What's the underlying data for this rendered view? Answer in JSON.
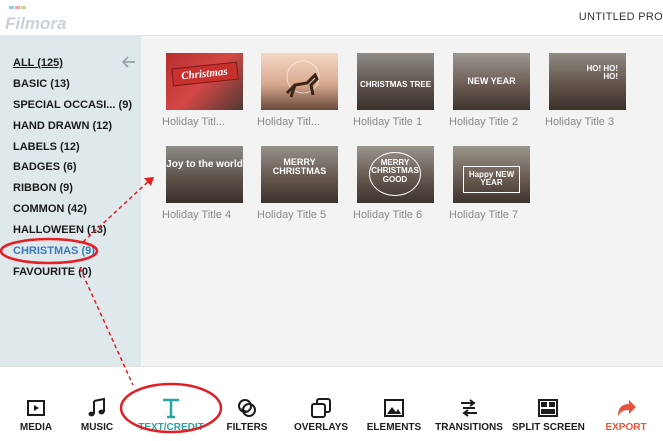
{
  "header": {
    "logo_text": "Filmora",
    "project_title": "UNTITLED PRO"
  },
  "sidebar": {
    "back_icon": "arrow-left-icon",
    "items": [
      {
        "label": "ALL (125)",
        "selected": false,
        "underline": true
      },
      {
        "label": "BASIC (13)"
      },
      {
        "label": "SPECIAL OCCASI...  (9)"
      },
      {
        "label": "HAND DRAWN (12)"
      },
      {
        "label": "LABELS (12)"
      },
      {
        "label": "BADGES (6)"
      },
      {
        "label": "RIBBON (9)"
      },
      {
        "label": "COMMON (42)"
      },
      {
        "label": "HALLOWEEN (13)"
      },
      {
        "label": "CHRISTMAS (9)",
        "selected": true
      },
      {
        "label": "FAVOURITE (0)"
      }
    ]
  },
  "grid": {
    "items": [
      {
        "label": "Holiday Titl...",
        "thumb_text": "Christmas"
      },
      {
        "label": "Holiday Titl...",
        "thumb_text": ""
      },
      {
        "label": "Holiday Title 1",
        "thumb_text": "CHRISTMAS TREE"
      },
      {
        "label": "Holiday Title 2",
        "thumb_text": "NEW YEAR"
      },
      {
        "label": "Holiday Title 3",
        "thumb_text": "HO! HO! HO!"
      },
      {
        "label": "Holiday Title 4",
        "thumb_text": "Joy to the world"
      },
      {
        "label": "Holiday Title 5",
        "thumb_text": "MERRY CHRISTMAS"
      },
      {
        "label": "Holiday Title 6",
        "thumb_text": "MERRY CHRISTMAS GOOD"
      },
      {
        "label": "Holiday Title 7",
        "thumb_text": "Happy NEW YEAR"
      }
    ]
  },
  "toolbar": {
    "items": [
      {
        "label": "MEDIA",
        "icon": "media-icon"
      },
      {
        "label": "MUSIC",
        "icon": "music-note-icon"
      },
      {
        "label": "TEXT/CREDIT",
        "icon": "text-t-icon",
        "active": true
      },
      {
        "label": "FILTERS",
        "icon": "filters-icon"
      },
      {
        "label": "OVERLAYS",
        "icon": "overlays-icon"
      },
      {
        "label": "ELEMENTS",
        "icon": "image-icon"
      },
      {
        "label": "TRANSITIONS",
        "icon": "transitions-icon"
      },
      {
        "label": "SPLIT SCREEN",
        "icon": "split-screen-icon"
      },
      {
        "label": "EXPORT",
        "icon": "export-arrow-icon"
      }
    ]
  },
  "colors": {
    "sidebar_bg": "#dfe8ea",
    "content_bg": "#f4f3f4",
    "accent_teal": "#2aa5a6",
    "export_red": "#e6553b",
    "annotation_red": "#e31e24",
    "selected_blue": "#3a7bbf"
  }
}
